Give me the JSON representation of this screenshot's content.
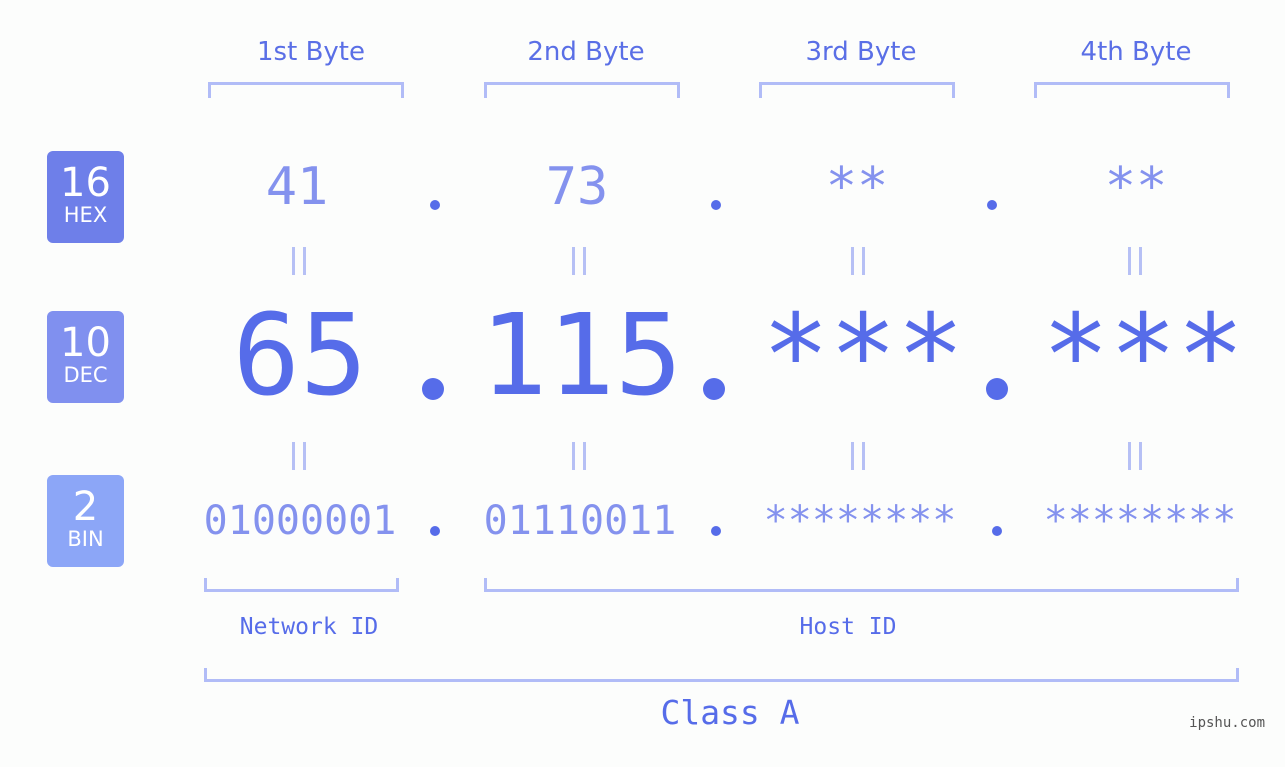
{
  "colors": {
    "hex_badge": "#6e7fe9",
    "dec_badge": "#8090ef",
    "bin_badge": "#8ca6f7",
    "accent": "#566ce9",
    "light_value": "#8492ee",
    "bracket": "#b1bcf7"
  },
  "badges": [
    {
      "number": "16",
      "label": "HEX"
    },
    {
      "number": "10",
      "label": "DEC"
    },
    {
      "number": "2",
      "label": "BIN"
    }
  ],
  "byte_headers": [
    "1st Byte",
    "2nd Byte",
    "3rd Byte",
    "4th Byte"
  ],
  "hex_values": [
    "41",
    "73",
    "**",
    "**"
  ],
  "dec_values": [
    "65",
    "115",
    "***",
    "***"
  ],
  "bin_values": [
    "01000001",
    "01110011",
    "********",
    "********"
  ],
  "separator": ".",
  "segments": {
    "network_id": "Network ID",
    "host_id": "Host ID"
  },
  "class_label": "Class A",
  "watermark": "ipshu.com"
}
